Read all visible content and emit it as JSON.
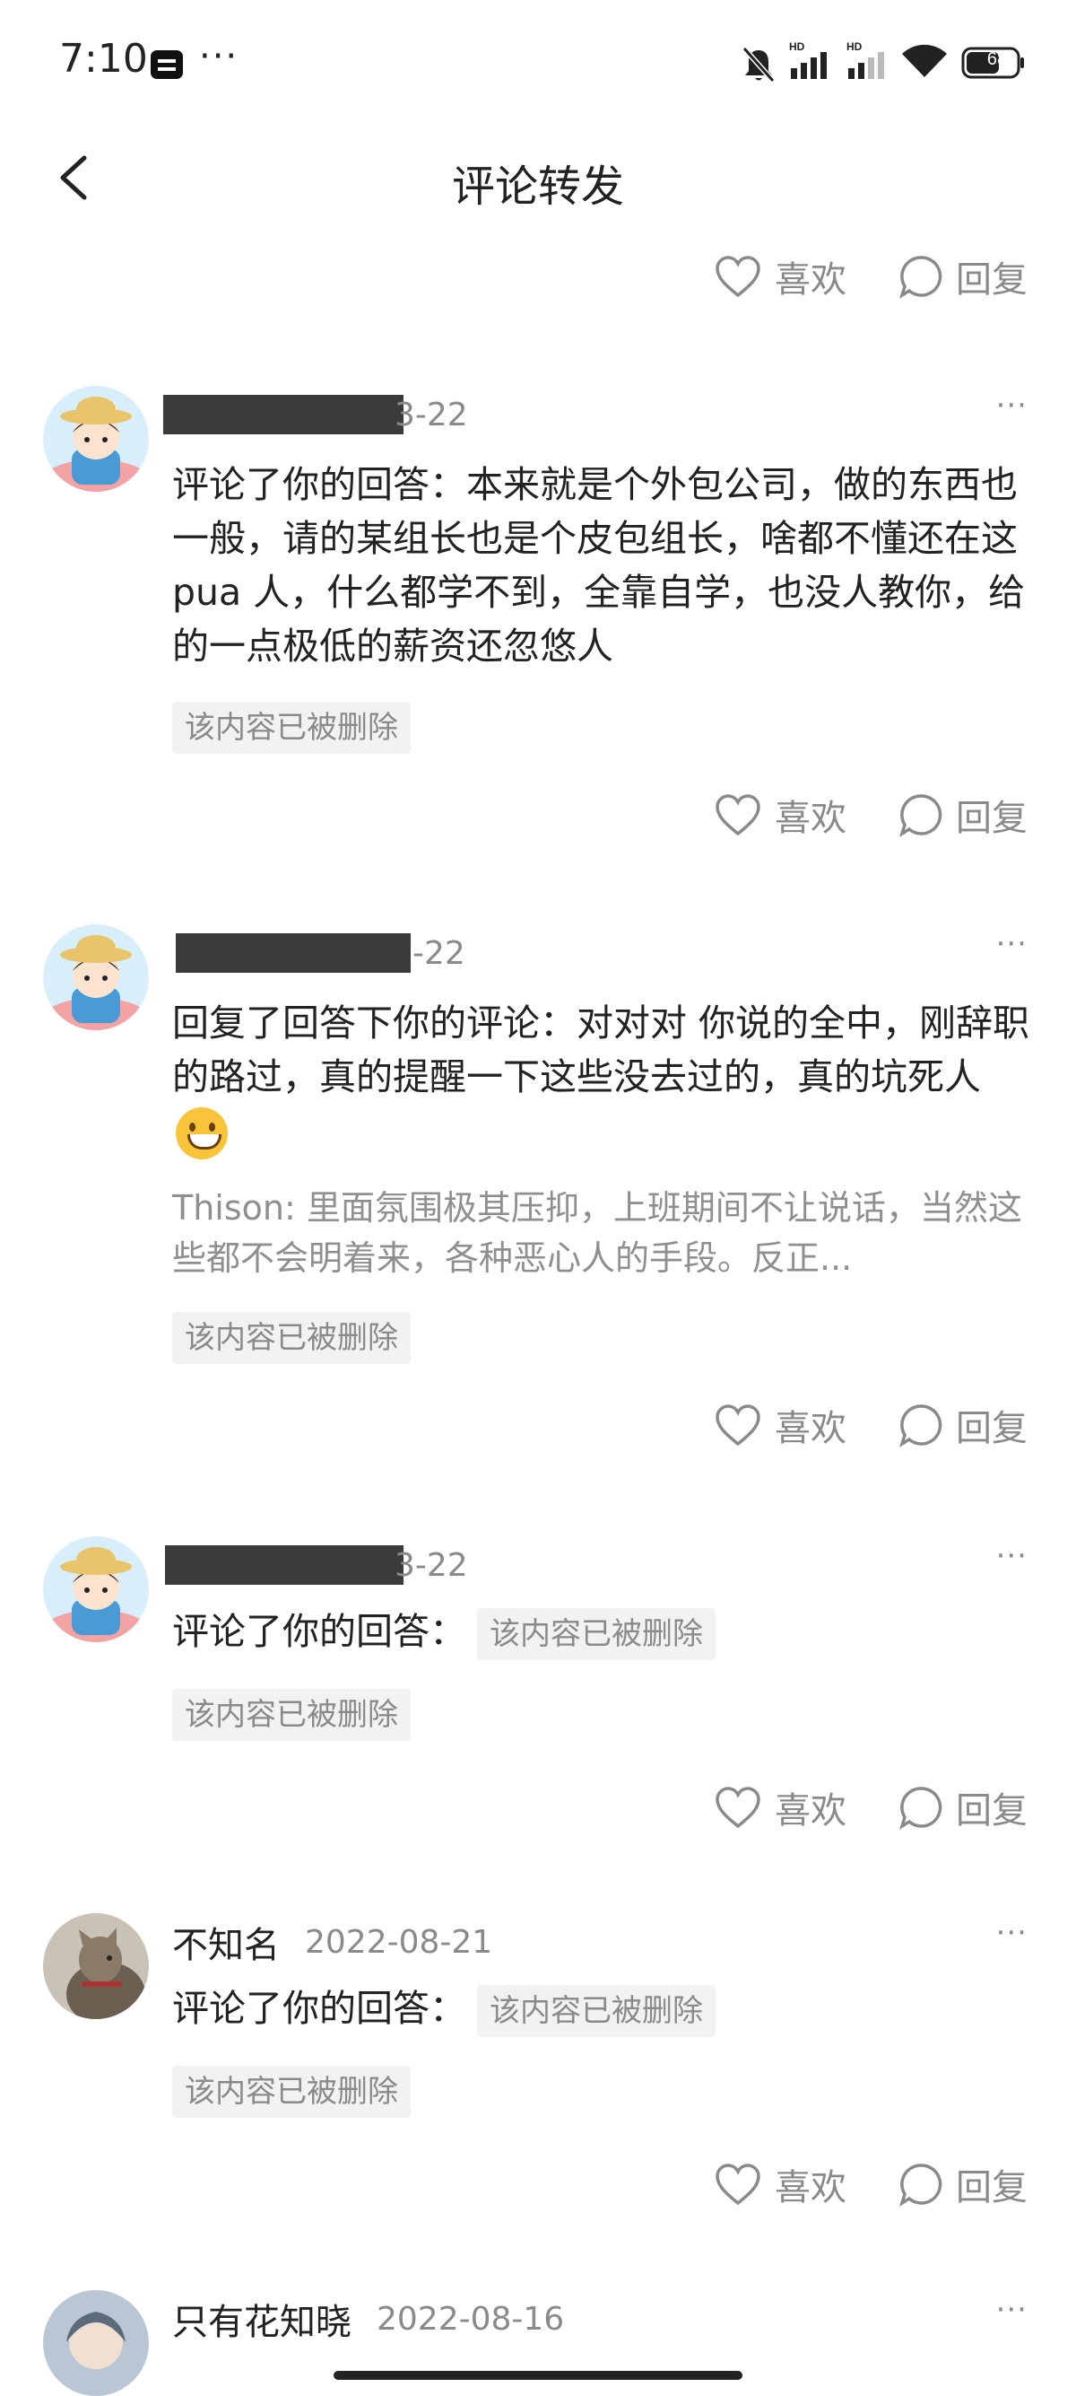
{
  "status_bar": {
    "time": "7:10",
    "more": "···",
    "battery": "68",
    "network_label_1": "HD",
    "network_label_2": "HD"
  },
  "header": {
    "title": "评论转发"
  },
  "actions": {
    "like_label": "喜欢",
    "reply_label": "回复"
  },
  "more_glyph": "···",
  "comments": [
    {
      "name": "",
      "date": "3-22",
      "body": "评论了你的回答：本来就是个外包公司，做的东西也一般，请的某组长也是个皮包组长，啥都不懂还在这pua 人，什么都学不到，全靠自学，也没人教你，给的一点极低的薪资还忽悠人",
      "deleted": "该内容已被删除"
    },
    {
      "name": "",
      "date": "-22",
      "body": "回复了回答下你的评论：对对对 你说的全中，刚辞职的路过，真的提醒一下这些没去过的，真的坑死人",
      "quote": "Thison: 里面氛围极其压抑，上班期间不让说话，当然这些都不会明着来，各种恶心人的手段。反正...",
      "deleted": "该内容已被删除"
    },
    {
      "name": "",
      "date": "3-22",
      "body": "评论了你的回答：",
      "inline_deleted": "该内容已被删除",
      "deleted": "该内容已被删除"
    },
    {
      "name": "不知名",
      "date": "2022-08-21",
      "body": "评论了你的回答：",
      "inline_deleted": "该内容已被删除",
      "deleted": "该内容已被删除"
    },
    {
      "name": "只有花知晓",
      "date": "2022-08-16"
    }
  ]
}
